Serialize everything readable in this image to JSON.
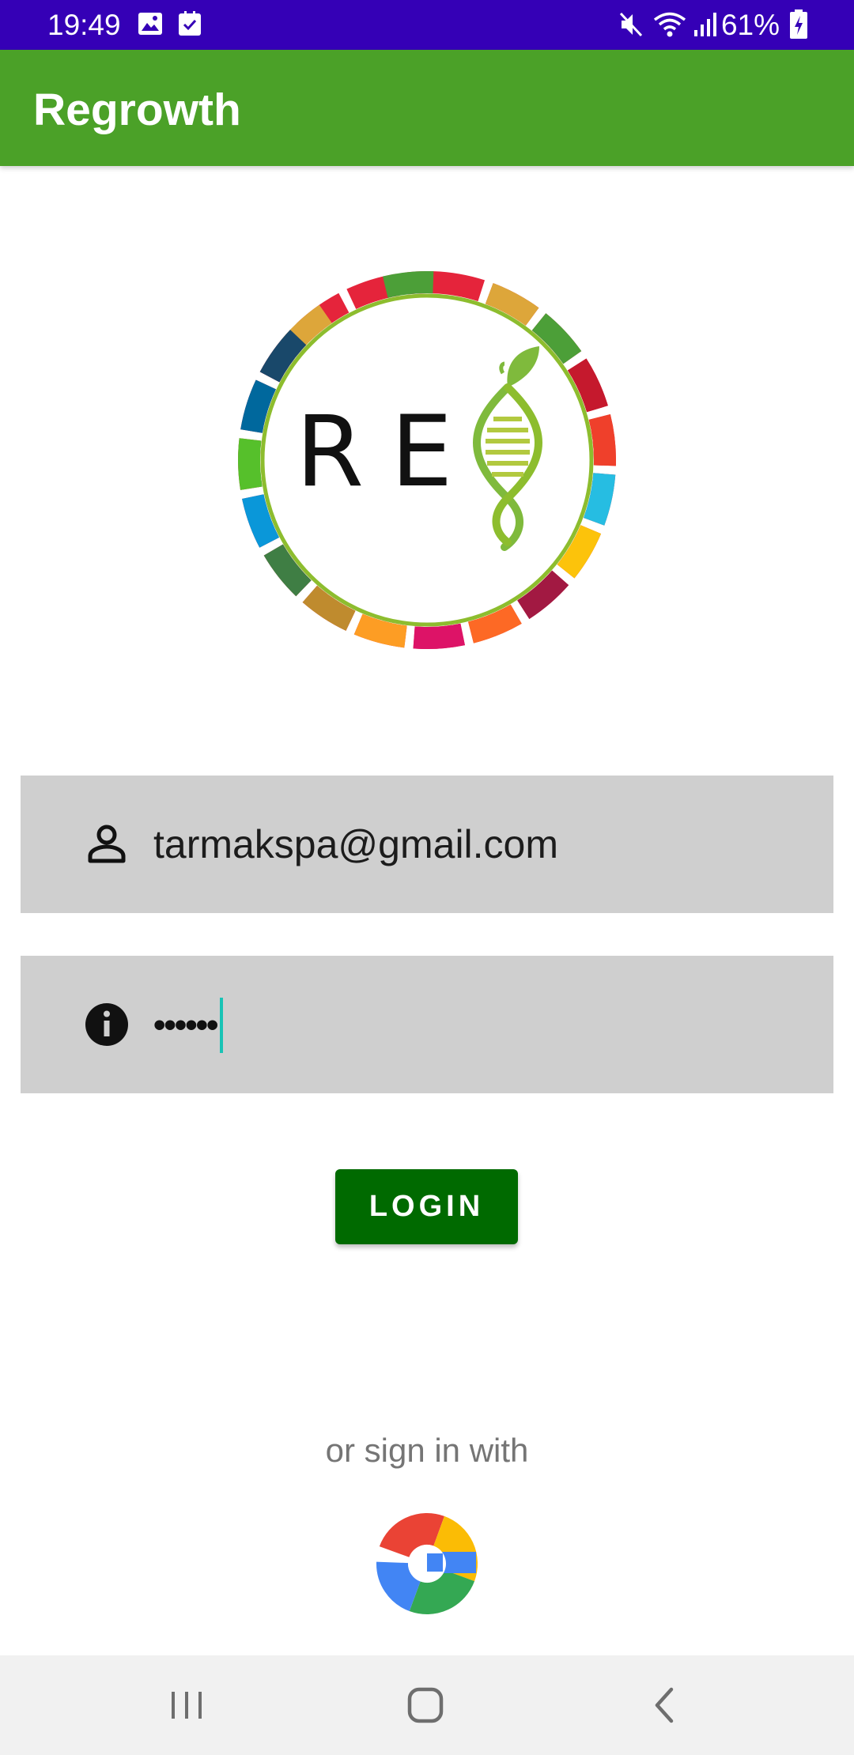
{
  "status_bar": {
    "time": "19:49",
    "battery": "61%",
    "icons": [
      "gallery-icon",
      "checkbox-icon",
      "mute-icon",
      "wifi-icon",
      "signal-icon",
      "battery-icon"
    ],
    "background": "#3500b6"
  },
  "app_bar": {
    "title": "Regrowth",
    "background": "#4ba128"
  },
  "logo": {
    "letters": "RE",
    "icon": "dna-leaf-icon"
  },
  "email_field": {
    "value": "tarmakspa@gmail.com",
    "icon": "person-icon"
  },
  "password_field": {
    "masked_value": "••••••",
    "icon": "info-icon"
  },
  "login_button": {
    "label": "LOGIN",
    "color": "#006a00"
  },
  "social": {
    "label": "or sign in with",
    "google_icon": "google-icon"
  },
  "nav_bar": {
    "items": [
      "recent-apps-icon",
      "home-icon",
      "back-icon"
    ]
  }
}
